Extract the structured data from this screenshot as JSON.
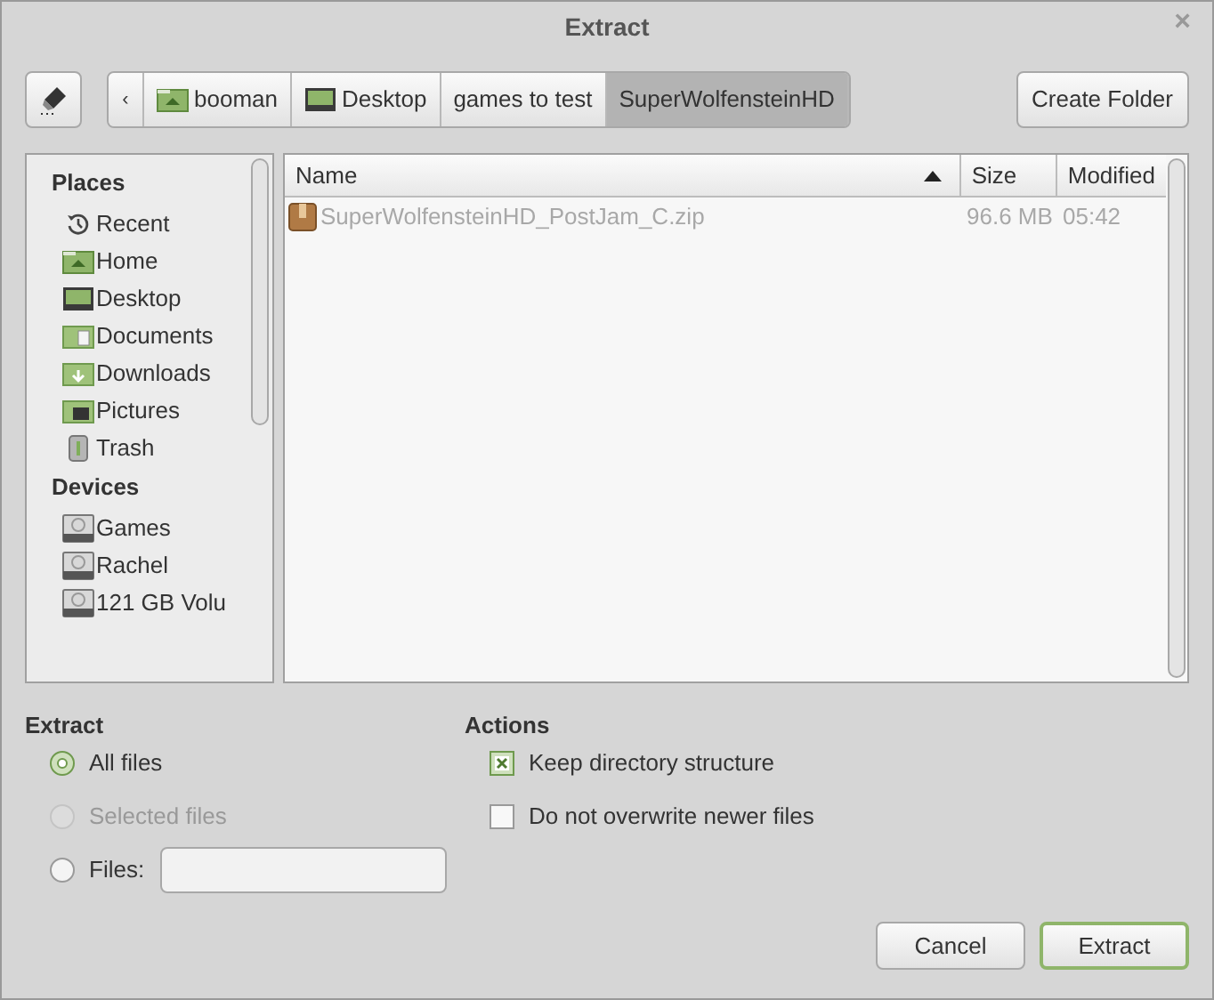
{
  "window": {
    "title": "Extract",
    "close": "×"
  },
  "path_bar": {
    "back": "‹",
    "crumbs": [
      {
        "label": "booman",
        "kind": "home",
        "selected": false
      },
      {
        "label": "Desktop",
        "kind": "desktop",
        "selected": false
      },
      {
        "label": "games to test",
        "kind": "plain",
        "selected": false
      },
      {
        "label": "SuperWolfensteinHD",
        "kind": "plain",
        "selected": true
      }
    ]
  },
  "create_folder": "Create Folder",
  "sidebar": {
    "sections": [
      {
        "title": "Places",
        "items": [
          {
            "label": "Recent",
            "kind": "recent"
          },
          {
            "label": "Home",
            "kind": "home"
          },
          {
            "label": "Desktop",
            "kind": "desktop"
          },
          {
            "label": "Documents",
            "kind": "documents"
          },
          {
            "label": "Downloads",
            "kind": "downloads"
          },
          {
            "label": "Pictures",
            "kind": "pictures"
          },
          {
            "label": "Trash",
            "kind": "trash"
          }
        ]
      },
      {
        "title": "Devices",
        "items": [
          {
            "label": "Games",
            "kind": "drive"
          },
          {
            "label": "Rachel",
            "kind": "drive"
          },
          {
            "label": "121 GB Volu",
            "kind": "drive"
          }
        ]
      }
    ]
  },
  "table": {
    "columns": [
      {
        "label": "Name",
        "sorted": true
      },
      {
        "label": "Size",
        "sorted": false
      },
      {
        "label": "Modified",
        "sorted": false
      }
    ],
    "rows": [
      {
        "name": "SuperWolfensteinHD_PostJam_C.zip",
        "size": "96.6 MB",
        "modified": "05:42"
      }
    ]
  },
  "extract": {
    "title": "Extract",
    "options": [
      {
        "label": "All files",
        "selected": true,
        "disabled": false
      },
      {
        "label": "Selected files",
        "selected": false,
        "disabled": true
      },
      {
        "label": "Files:",
        "selected": false,
        "disabled": false,
        "field": true
      }
    ]
  },
  "actions": {
    "title": "Actions",
    "options": [
      {
        "label": "Keep directory structure",
        "checked": true
      },
      {
        "label": "Do not overwrite newer files",
        "checked": false
      }
    ]
  },
  "buttons": [
    {
      "label": "Cancel",
      "default": false
    },
    {
      "label": "Extract",
      "default": true
    }
  ]
}
